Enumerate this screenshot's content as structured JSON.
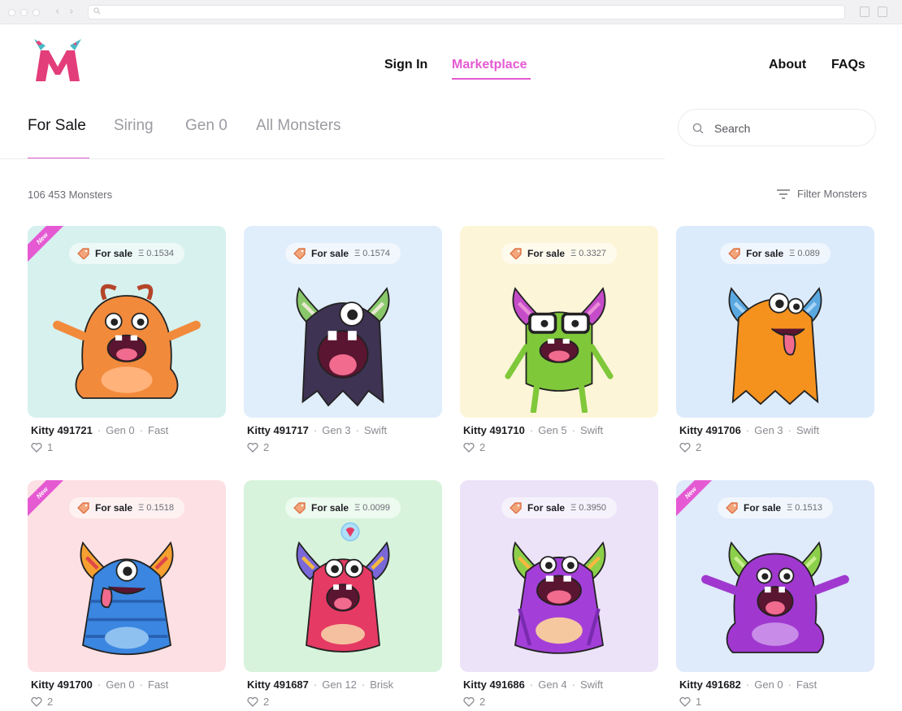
{
  "nav": {
    "sign_in": "Sign In",
    "marketplace": "Marketplace",
    "about": "About",
    "faqs": "FAQs"
  },
  "tabs": [
    {
      "label": "For Sale",
      "active": true
    },
    {
      "label": "Siring",
      "active": false
    },
    {
      "label": "Gen 0",
      "active": false
    },
    {
      "label": "All Monsters",
      "active": false
    }
  ],
  "search": {
    "placeholder": "Search"
  },
  "results": {
    "count": "106 453 Monsters",
    "filter_label": "Filter Monsters"
  },
  "cards": [
    {
      "name": "Kitty 491721",
      "gen": "Gen 0",
      "speed": "Fast",
      "likes": "1",
      "status": "For sale",
      "price": "Ξ 0.1534",
      "badge": "New",
      "bg": "#d6f1ee",
      "monster": "orange-furry"
    },
    {
      "name": "Kitty 491717",
      "gen": "Gen 3",
      "speed": "Swift",
      "likes": "2",
      "status": "For sale",
      "price": "Ξ 0.1574",
      "badge": "",
      "bg": "#e0edfb",
      "monster": "dark-purple-ghost"
    },
    {
      "name": "Kitty 491710",
      "gen": "Gen 5",
      "speed": "Swift",
      "likes": "2",
      "status": "For sale",
      "price": "Ξ 0.3327",
      "badge": "",
      "bg": "#fdf5d8",
      "monster": "green-glasses"
    },
    {
      "name": "Kitty 491706",
      "gen": "Gen 3",
      "speed": "Swift",
      "likes": "2",
      "status": "For sale",
      "price": "Ξ 0.089",
      "badge": "",
      "bg": "#dcebfb",
      "monster": "orange-ghost"
    },
    {
      "name": "Kitty 491700",
      "gen": "Gen 0",
      "speed": "Fast",
      "likes": "2",
      "status": "For sale",
      "price": "Ξ 0.1518",
      "badge": "New",
      "bg": "#fde0e3",
      "monster": "blue-striped"
    },
    {
      "name": "Kitty 491687",
      "gen": "Gen 12",
      "speed": "Brisk",
      "likes": "2",
      "status": "For sale",
      "price": "Ξ 0.0099",
      "badge": "",
      "bg": "#d7f3dc",
      "monster": "pink-horned"
    },
    {
      "name": "Kitty 491686",
      "gen": "Gen 4",
      "speed": "Swift",
      "likes": "2",
      "status": "For sale",
      "price": "Ξ 0.3950",
      "badge": "",
      "bg": "#ece3f8",
      "monster": "purple-striped"
    },
    {
      "name": "Kitty 491682",
      "gen": "Gen 0",
      "speed": "Fast",
      "likes": "1",
      "status": "For sale",
      "price": "Ξ 0.1513",
      "badge": "New",
      "bg": "#dfeafb",
      "monster": "purple-furry"
    }
  ],
  "colors": {
    "accent": "#e55ad3",
    "text": "#1d1d22",
    "muted": "#8a8a91"
  }
}
